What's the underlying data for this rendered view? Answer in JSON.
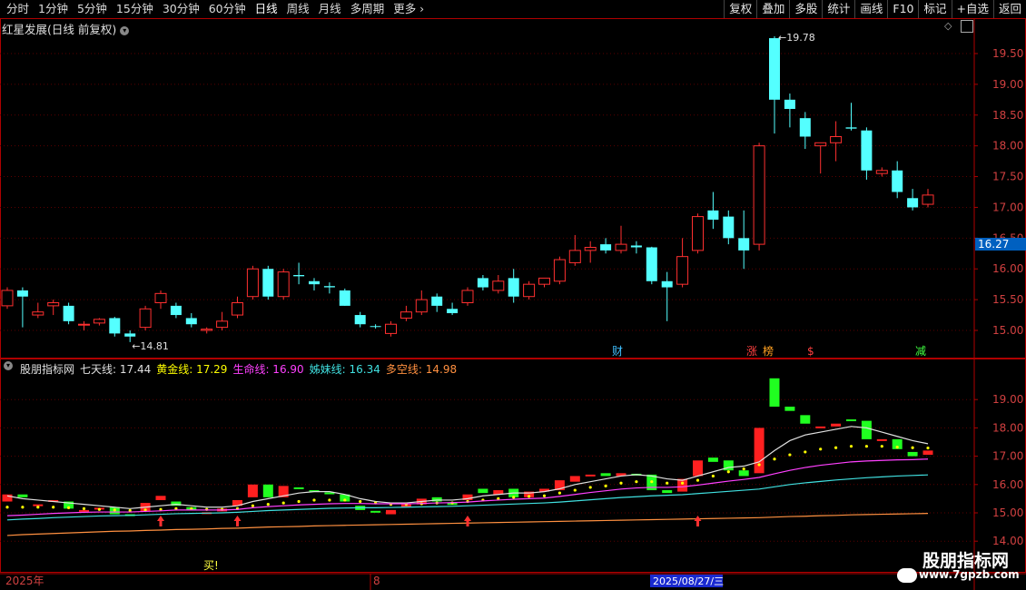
{
  "toolbar": {
    "left": [
      "分时",
      "1分钟",
      "5分钟",
      "15分钟",
      "30分钟",
      "60分钟",
      "日线",
      "周线",
      "月线",
      "多周期",
      "更多"
    ],
    "active": "日线",
    "more_arrow": "›",
    "right": [
      "复权",
      "叠加",
      "多股",
      "统计",
      "画线",
      "F10",
      "标记",
      "+自选",
      "返回"
    ]
  },
  "main_panel": {
    "title": "红星发展(日线 前复权)",
    "y_ticks": [
      "19.50",
      "19.00",
      "18.50",
      "18.00",
      "17.50",
      "17.00",
      "16.50",
      "16.00",
      "15.50",
      "15.00"
    ],
    "current_price": "16.27",
    "high_label": "19.78",
    "low_label": "14.81",
    "markers": [
      {
        "text": "财",
        "color": "#40c0ff"
      },
      {
        "text": "涨",
        "color": "#ff4040"
      },
      {
        "text": "榜",
        "color": "#ffa020"
      },
      {
        "text": "$",
        "color": "#ff4040"
      },
      {
        "text": "减",
        "color": "#40ff40"
      }
    ]
  },
  "indicator_panel": {
    "name": "股朋指标网",
    "lines": [
      {
        "label": "七天线:",
        "value": "17.44",
        "color": "#e0e0e0"
      },
      {
        "label": "黄金线:",
        "value": "17.29",
        "color": "#ffff00"
      },
      {
        "label": "生命线:",
        "value": "16.90",
        "color": "#ff40ff"
      },
      {
        "label": "姊妹线:",
        "value": "16.34",
        "color": "#40e0e0"
      },
      {
        "label": "多空线:",
        "value": "14.98",
        "color": "#ff9040"
      }
    ],
    "y_ticks": [
      "19.00",
      "18.00",
      "17.00",
      "16.00",
      "15.00",
      "14.00"
    ],
    "buy_label": "买!"
  },
  "time_axis": {
    "labels": [
      "2025年",
      "8"
    ],
    "cursor_date": "2025/08/27/三"
  },
  "watermark": {
    "title": "股朋指标网",
    "url": "www.7gpzb.com"
  },
  "colors": {
    "up": "#ff3030",
    "down": "#54ffff",
    "grid": "#5a0000",
    "axis": "#b00000"
  },
  "chart_data": {
    "type": "candlestick",
    "title": "红星发展(日线 前复权)",
    "ylim": [
      14.7,
      19.9
    ],
    "candles": [
      {
        "o": 15.4,
        "h": 15.7,
        "l": 15.35,
        "c": 15.65
      },
      {
        "o": 15.65,
        "h": 15.7,
        "l": 15.05,
        "c": 15.55
      },
      {
        "o": 15.25,
        "h": 15.45,
        "l": 15.2,
        "c": 15.3
      },
      {
        "o": 15.4,
        "h": 15.5,
        "l": 15.25,
        "c": 15.45
      },
      {
        "o": 15.4,
        "h": 15.45,
        "l": 15.1,
        "c": 15.15
      },
      {
        "o": 15.1,
        "h": 15.15,
        "l": 15.0,
        "c": 15.1
      },
      {
        "o": 15.12,
        "h": 15.2,
        "l": 15.08,
        "c": 15.18
      },
      {
        "o": 15.2,
        "h": 15.22,
        "l": 14.9,
        "c": 14.95
      },
      {
        "o": 14.95,
        "h": 15.0,
        "l": 14.81,
        "c": 14.9
      },
      {
        "o": 15.05,
        "h": 15.4,
        "l": 15.0,
        "c": 15.35
      },
      {
        "o": 15.45,
        "h": 15.65,
        "l": 15.35,
        "c": 15.6
      },
      {
        "o": 15.4,
        "h": 15.45,
        "l": 15.2,
        "c": 15.25
      },
      {
        "o": 15.2,
        "h": 15.28,
        "l": 15.05,
        "c": 15.1
      },
      {
        "o": 15.0,
        "h": 15.05,
        "l": 14.95,
        "c": 15.02
      },
      {
        "o": 15.05,
        "h": 15.3,
        "l": 15.0,
        "c": 15.15
      },
      {
        "o": 15.25,
        "h": 15.55,
        "l": 15.2,
        "c": 15.45
      },
      {
        "o": 15.55,
        "h": 16.05,
        "l": 15.5,
        "c": 16.0
      },
      {
        "o": 16.0,
        "h": 16.05,
        "l": 15.5,
        "c": 15.55
      },
      {
        "o": 15.55,
        "h": 16.0,
        "l": 15.5,
        "c": 15.95
      },
      {
        "o": 15.9,
        "h": 16.1,
        "l": 15.75,
        "c": 15.88
      },
      {
        "o": 15.8,
        "h": 15.85,
        "l": 15.65,
        "c": 15.75
      },
      {
        "o": 15.72,
        "h": 15.78,
        "l": 15.6,
        "c": 15.7
      },
      {
        "o": 15.65,
        "h": 15.68,
        "l": 15.4,
        "c": 15.4
      },
      {
        "o": 15.25,
        "h": 15.3,
        "l": 15.05,
        "c": 15.1
      },
      {
        "o": 15.07,
        "h": 15.1,
        "l": 15.03,
        "c": 15.06
      },
      {
        "o": 14.95,
        "h": 15.15,
        "l": 14.9,
        "c": 15.1
      },
      {
        "o": 15.2,
        "h": 15.4,
        "l": 15.15,
        "c": 15.3
      },
      {
        "o": 15.3,
        "h": 15.65,
        "l": 15.25,
        "c": 15.5
      },
      {
        "o": 15.55,
        "h": 15.6,
        "l": 15.3,
        "c": 15.4
      },
      {
        "o": 15.35,
        "h": 15.45,
        "l": 15.25,
        "c": 15.28
      },
      {
        "o": 15.45,
        "h": 15.7,
        "l": 15.4,
        "c": 15.65
      },
      {
        "o": 15.85,
        "h": 15.9,
        "l": 15.65,
        "c": 15.7
      },
      {
        "o": 15.65,
        "h": 15.9,
        "l": 15.6,
        "c": 15.8
      },
      {
        "o": 15.85,
        "h": 16.0,
        "l": 15.45,
        "c": 15.55
      },
      {
        "o": 15.55,
        "h": 15.8,
        "l": 15.5,
        "c": 15.75
      },
      {
        "o": 15.75,
        "h": 15.85,
        "l": 15.7,
        "c": 15.85
      },
      {
        "o": 15.8,
        "h": 16.2,
        "l": 15.75,
        "c": 16.15
      },
      {
        "o": 16.1,
        "h": 16.55,
        "l": 16.05,
        "c": 16.3
      },
      {
        "o": 16.3,
        "h": 16.45,
        "l": 16.1,
        "c": 16.35
      },
      {
        "o": 16.4,
        "h": 16.5,
        "l": 16.25,
        "c": 16.3
      },
      {
        "o": 16.3,
        "h": 16.7,
        "l": 16.25,
        "c": 16.4
      },
      {
        "o": 16.38,
        "h": 16.45,
        "l": 16.25,
        "c": 16.35
      },
      {
        "o": 16.35,
        "h": 16.36,
        "l": 15.75,
        "c": 15.8
      },
      {
        "o": 15.8,
        "h": 15.95,
        "l": 15.15,
        "c": 15.7
      },
      {
        "o": 15.75,
        "h": 16.5,
        "l": 15.7,
        "c": 16.2
      },
      {
        "o": 16.3,
        "h": 16.9,
        "l": 16.25,
        "c": 16.85
      },
      {
        "o": 16.95,
        "h": 17.25,
        "l": 16.65,
        "c": 16.8
      },
      {
        "o": 16.85,
        "h": 16.95,
        "l": 16.4,
        "c": 16.5
      },
      {
        "o": 16.5,
        "h": 16.95,
        "l": 16.0,
        "c": 16.3
      },
      {
        "o": 16.4,
        "h": 18.05,
        "l": 16.3,
        "c": 18.0
      },
      {
        "o": 19.75,
        "h": 19.78,
        "l": 18.2,
        "c": 18.75
      },
      {
        "o": 18.75,
        "h": 18.85,
        "l": 18.3,
        "c": 18.6
      },
      {
        "o": 18.45,
        "h": 18.55,
        "l": 17.95,
        "c": 18.15
      },
      {
        "o": 18.0,
        "h": 18.05,
        "l": 17.55,
        "c": 18.05
      },
      {
        "o": 18.05,
        "h": 18.4,
        "l": 17.75,
        "c": 18.15
      },
      {
        "o": 18.3,
        "h": 18.7,
        "l": 18.25,
        "c": 18.28
      },
      {
        "o": 18.25,
        "h": 18.3,
        "l": 17.45,
        "c": 17.6
      },
      {
        "o": 17.55,
        "h": 17.65,
        "l": 17.5,
        "c": 17.6
      },
      {
        "o": 17.6,
        "h": 17.75,
        "l": 17.15,
        "c": 17.25
      },
      {
        "o": 17.15,
        "h": 17.3,
        "l": 16.95,
        "c": 17.0
      },
      {
        "o": 17.05,
        "h": 17.3,
        "l": 17.0,
        "c": 17.2
      }
    ],
    "indicator": {
      "ylim": [
        13.8,
        20.0
      ],
      "candles": [
        {
          "o": 15.4,
          "c": 15.65
        },
        {
          "o": 15.65,
          "c": 15.55
        },
        {
          "o": 15.25,
          "c": 15.3
        },
        {
          "o": 15.4,
          "c": 15.45
        },
        {
          "o": 15.4,
          "c": 15.15
        },
        {
          "o": 15.1,
          "c": 15.1
        },
        {
          "o": 15.12,
          "c": 15.18
        },
        {
          "o": 15.2,
          "c": 14.95
        },
        {
          "o": 14.95,
          "c": 14.9
        },
        {
          "o": 15.05,
          "c": 15.35
        },
        {
          "o": 15.45,
          "c": 15.6
        },
        {
          "o": 15.4,
          "c": 15.25
        },
        {
          "o": 15.2,
          "c": 15.1
        },
        {
          "o": 15.0,
          "c": 15.02
        },
        {
          "o": 15.05,
          "c": 15.15
        },
        {
          "o": 15.25,
          "c": 15.45
        },
        {
          "o": 15.55,
          "c": 16.0
        },
        {
          "o": 16.0,
          "c": 15.55
        },
        {
          "o": 15.55,
          "c": 15.95
        },
        {
          "o": 15.9,
          "c": 15.88
        },
        {
          "o": 15.8,
          "c": 15.75
        },
        {
          "o": 15.72,
          "c": 15.7
        },
        {
          "o": 15.65,
          "c": 15.4
        },
        {
          "o": 15.25,
          "c": 15.1
        },
        {
          "o": 15.07,
          "c": 15.06
        },
        {
          "o": 14.95,
          "c": 15.1
        },
        {
          "o": 15.2,
          "c": 15.3
        },
        {
          "o": 15.3,
          "c": 15.5
        },
        {
          "o": 15.55,
          "c": 15.4
        },
        {
          "o": 15.35,
          "c": 15.28
        },
        {
          "o": 15.45,
          "c": 15.65
        },
        {
          "o": 15.85,
          "c": 15.7
        },
        {
          "o": 15.65,
          "c": 15.8
        },
        {
          "o": 15.85,
          "c": 15.55
        },
        {
          "o": 15.55,
          "c": 15.75
        },
        {
          "o": 15.75,
          "c": 15.85
        },
        {
          "o": 15.8,
          "c": 16.15
        },
        {
          "o": 16.1,
          "c": 16.3
        },
        {
          "o": 16.3,
          "c": 16.35
        },
        {
          "o": 16.4,
          "c": 16.3
        },
        {
          "o": 16.3,
          "c": 16.4
        },
        {
          "o": 16.38,
          "c": 16.35
        },
        {
          "o": 16.35,
          "c": 15.8
        },
        {
          "o": 15.8,
          "c": 15.7
        },
        {
          "o": 15.75,
          "c": 16.2
        },
        {
          "o": 16.3,
          "c": 16.85
        },
        {
          "o": 16.95,
          "c": 16.8
        },
        {
          "o": 16.85,
          "c": 16.5
        },
        {
          "o": 16.5,
          "c": 16.3
        },
        {
          "o": 16.4,
          "c": 18.0
        },
        {
          "o": 19.75,
          "c": 18.75
        },
        {
          "o": 18.75,
          "c": 18.6
        },
        {
          "o": 18.45,
          "c": 18.15
        },
        {
          "o": 18.0,
          "c": 18.05
        },
        {
          "o": 18.05,
          "c": 18.15
        },
        {
          "o": 18.3,
          "c": 18.28
        },
        {
          "o": 18.25,
          "c": 17.6
        },
        {
          "o": 17.55,
          "c": 17.6
        },
        {
          "o": 17.6,
          "c": 17.25
        },
        {
          "o": 17.15,
          "c": 17.0
        },
        {
          "o": 17.05,
          "c": 17.2
        }
      ],
      "series": [
        {
          "name": "七天线",
          "color": "#e0e0e0",
          "values": [
            15.6,
            15.5,
            15.45,
            15.4,
            15.35,
            15.3,
            15.25,
            15.2,
            15.15,
            15.2,
            15.25,
            15.3,
            15.25,
            15.2,
            15.2,
            15.25,
            15.4,
            15.5,
            15.6,
            15.7,
            15.75,
            15.75,
            15.65,
            15.5,
            15.4,
            15.35,
            15.35,
            15.4,
            15.45,
            15.45,
            15.5,
            15.6,
            15.65,
            15.7,
            15.7,
            15.75,
            15.85,
            16.0,
            16.1,
            16.2,
            16.3,
            16.35,
            16.3,
            16.2,
            16.15,
            16.3,
            16.45,
            16.6,
            16.65,
            16.8,
            17.2,
            17.55,
            17.75,
            17.85,
            17.95,
            18.05,
            18.0,
            17.85,
            17.7,
            17.55,
            17.44
          ]
        },
        {
          "name": "黄金线",
          "color": "#ffff00",
          "values": [
            15.2,
            15.2,
            15.2,
            15.2,
            15.18,
            15.15,
            15.12,
            15.1,
            15.08,
            15.1,
            15.12,
            15.15,
            15.15,
            15.12,
            15.12,
            15.15,
            15.25,
            15.3,
            15.35,
            15.4,
            15.45,
            15.45,
            15.45,
            15.4,
            15.35,
            15.3,
            15.3,
            15.32,
            15.35,
            15.35,
            15.4,
            15.45,
            15.5,
            15.55,
            15.58,
            15.6,
            15.7,
            15.8,
            15.9,
            15.95,
            16.05,
            16.1,
            16.1,
            16.05,
            16.05,
            16.15,
            16.3,
            16.45,
            16.55,
            16.7,
            16.9,
            17.05,
            17.15,
            17.25,
            17.3,
            17.35,
            17.35,
            17.35,
            17.32,
            17.3,
            17.29
          ]
        },
        {
          "name": "生命线",
          "color": "#ff40ff",
          "values": [
            14.9,
            14.92,
            14.95,
            14.98,
            15.0,
            15.02,
            15.03,
            15.03,
            15.03,
            15.05,
            15.07,
            15.1,
            15.1,
            15.1,
            15.1,
            15.12,
            15.18,
            15.22,
            15.25,
            15.28,
            15.3,
            15.32,
            15.33,
            15.33,
            15.32,
            15.32,
            15.32,
            15.33,
            15.35,
            15.36,
            15.38,
            15.42,
            15.45,
            15.48,
            15.5,
            15.52,
            15.58,
            15.65,
            15.72,
            15.78,
            15.84,
            15.88,
            15.9,
            15.9,
            15.92,
            15.98,
            16.05,
            16.12,
            16.18,
            16.25,
            16.38,
            16.5,
            16.6,
            16.68,
            16.74,
            16.8,
            16.83,
            16.85,
            16.87,
            16.88,
            16.9
          ]
        },
        {
          "name": "姊妹线",
          "color": "#40e0e0",
          "values": [
            14.75,
            14.78,
            14.8,
            14.83,
            14.85,
            14.87,
            14.89,
            14.9,
            14.91,
            14.93,
            14.95,
            14.97,
            14.98,
            14.99,
            15.0,
            15.02,
            15.05,
            15.08,
            15.1,
            15.12,
            15.14,
            15.16,
            15.17,
            15.18,
            15.18,
            15.19,
            15.2,
            15.21,
            15.22,
            15.23,
            15.25,
            15.27,
            15.29,
            15.31,
            15.33,
            15.35,
            15.38,
            15.42,
            15.46,
            15.5,
            15.54,
            15.57,
            15.6,
            15.62,
            15.64,
            15.68,
            15.72,
            15.76,
            15.8,
            15.84,
            15.92,
            16.0,
            16.06,
            16.11,
            16.16,
            16.2,
            16.24,
            16.27,
            16.3,
            16.32,
            16.34
          ]
        },
        {
          "name": "多空线",
          "color": "#ff9040",
          "values": [
            14.2,
            14.23,
            14.25,
            14.27,
            14.29,
            14.31,
            14.33,
            14.35,
            14.36,
            14.38,
            14.39,
            14.41,
            14.42,
            14.43,
            14.45,
            14.46,
            14.48,
            14.5,
            14.51,
            14.52,
            14.54,
            14.55,
            14.56,
            14.57,
            14.58,
            14.59,
            14.6,
            14.61,
            14.62,
            14.63,
            14.64,
            14.65,
            14.66,
            14.67,
            14.68,
            14.69,
            14.7,
            14.71,
            14.72,
            14.73,
            14.74,
            14.75,
            14.76,
            14.77,
            14.78,
            14.79,
            14.8,
            14.81,
            14.82,
            14.83,
            14.85,
            14.87,
            14.88,
            14.9,
            14.91,
            14.93,
            14.94,
            14.95,
            14.96,
            14.97,
            14.98
          ]
        }
      ],
      "buy_signals": [
        10,
        15,
        30,
        45
      ]
    }
  }
}
